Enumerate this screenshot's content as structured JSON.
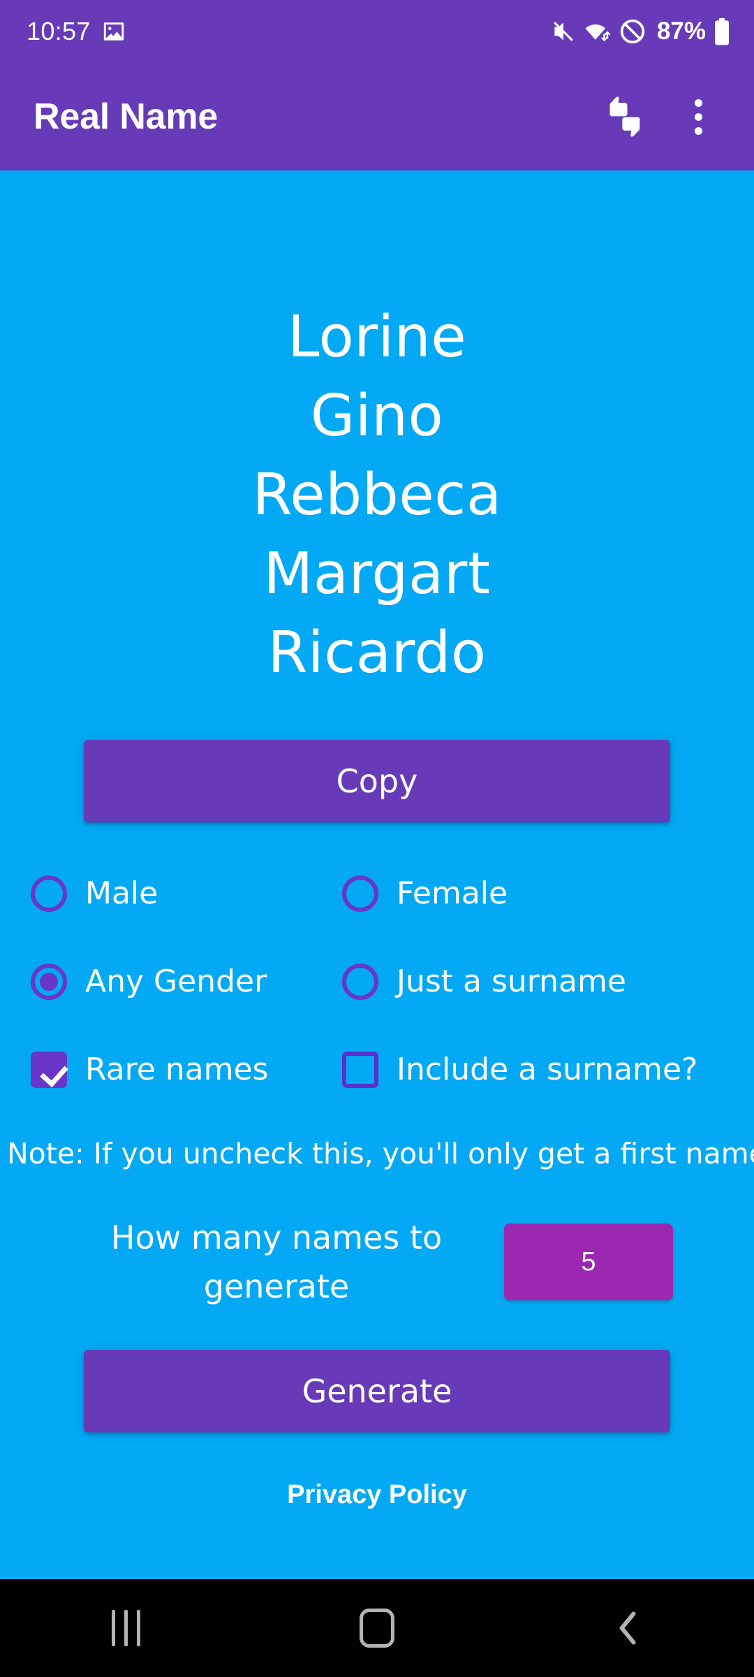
{
  "status_bar": {
    "time": "10:57",
    "battery_percent": "87%",
    "icons": [
      "image-icon",
      "mute-icon",
      "wifi-icon",
      "do-not-disturb-icon",
      "battery-icon"
    ]
  },
  "app_bar": {
    "title": "Real Name",
    "actions": [
      "feedback-thumbs-icon",
      "overflow-menu-icon"
    ]
  },
  "main": {
    "names": [
      "Lorine",
      "Gino",
      "Rebbeca",
      "Margart",
      "Ricardo"
    ],
    "copy_label": "Copy",
    "options": {
      "male": {
        "label": "Male",
        "selected": false
      },
      "female": {
        "label": "Female",
        "selected": false
      },
      "any_gender": {
        "label": "Any Gender",
        "selected": true
      },
      "just_surname": {
        "label": "Just a surname",
        "selected": false
      },
      "rare_names": {
        "label": "Rare names",
        "checked": true
      },
      "include_surname": {
        "label": "Include a surname?",
        "checked": false
      }
    },
    "note": "Note: If you uncheck this, you'll only get a first name.",
    "count_label": "How many names to generate",
    "count_value": "5",
    "generate_label": "Generate",
    "privacy_policy_label": "Privacy Policy"
  },
  "nav_bar": {
    "recents_label": "recents-icon",
    "home_label": "home-icon",
    "back_label": "back-icon"
  },
  "colors": {
    "primary": "#673AB7",
    "background": "#03A9F4",
    "accent": "#9C27B0",
    "control": "#6A35C8"
  }
}
